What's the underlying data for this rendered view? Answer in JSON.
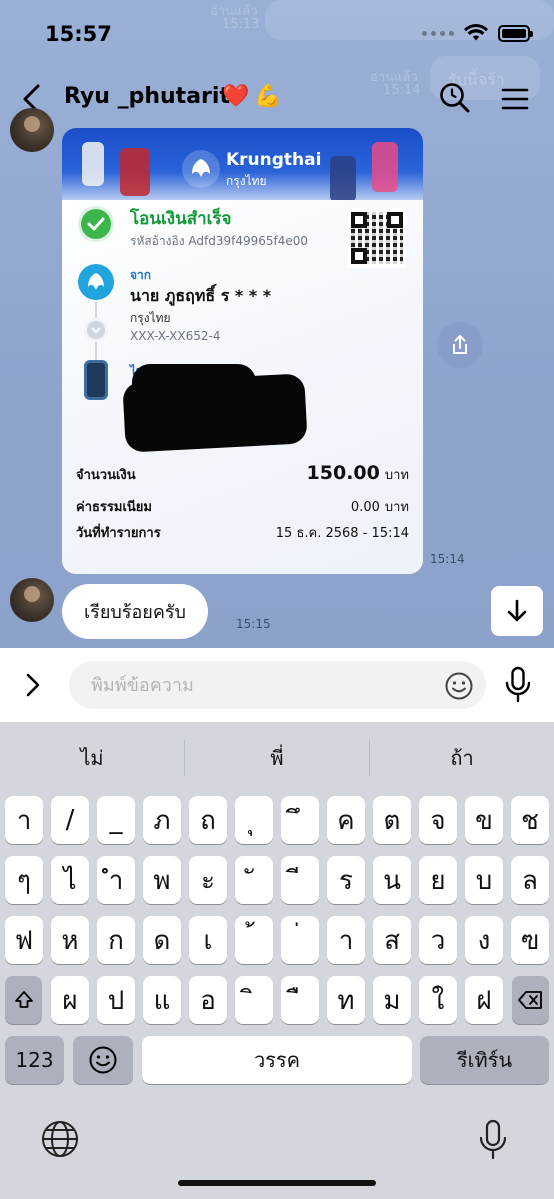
{
  "status_bar": {
    "time": "15:57"
  },
  "header": {
    "title": "Ryu _phutarit",
    "emoji_heart": "❤️",
    "emoji_muscle": "💪"
  },
  "ghost_bg": {
    "read": "อ่านแล้ว",
    "time1": "15:13",
    "time2": "15:14",
    "bubble": "รับนี้จร้า"
  },
  "receipt": {
    "bank_name": "Krungthai",
    "bank_name_th": "กรุงไทย",
    "status": "โอนเงินสำเร็จ",
    "reference": "รหัสอ้างอิง Adfd39f49965f4e00",
    "from_label": "จาก",
    "from_name": "นาย ภูธฤทธิ์ ร * * *",
    "from_bank": "กรุงไทย",
    "from_account": "XXX-X-XX652-4",
    "to_label": "ไปยัง",
    "amount_label": "จำนวนเงิน",
    "amount_value": "150.00",
    "amount_unit": "บาท",
    "fee_label": "ค่าธรรมเนียม",
    "fee_value": "0.00",
    "fee_unit": "บาท",
    "date_label": "วันที่ทำรายการ",
    "date_value": "15 ธ.ค. 2568 - 15:14"
  },
  "messages": {
    "receipt_time": "15:14",
    "text": "เรียบร้อยครับ",
    "text_time": "15:15"
  },
  "input": {
    "placeholder": "พิมพ์ข้อความ"
  },
  "keyboard": {
    "suggestions": [
      "ไม่",
      "พี่",
      "ถ้า"
    ],
    "row1": [
      "า",
      "/",
      "_",
      "ภ",
      "ถ",
      "ุ",
      "ึ",
      "ค",
      "ต",
      "จ",
      "ข",
      "ช"
    ],
    "row2": [
      "ๆ",
      "ไ",
      "ำ",
      "พ",
      "ะ",
      "ั",
      "ี",
      "ร",
      "น",
      "ย",
      "บ",
      "ล"
    ],
    "row3": [
      "ฟ",
      "ห",
      "ก",
      "ด",
      "เ",
      "้",
      "่",
      "า",
      "ส",
      "ว",
      "ง",
      "ฃ"
    ],
    "row4": [
      "ผ",
      "ป",
      "แ",
      "อ",
      "ิ",
      "ื",
      "ท",
      "ม",
      "ใ",
      "ฝ"
    ],
    "numbers_key": "123",
    "space_key": "วรรค",
    "return_key": "รีเทิร์น"
  },
  "colors": {
    "chat_bg": "#8fa4c9",
    "success_green": "#139b3a",
    "bank_blue": "#1e72c8"
  }
}
